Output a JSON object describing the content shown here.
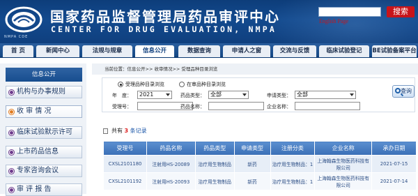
{
  "header": {
    "title": "国家药品监督管理局药品审评中心",
    "subtitle": "CENTER FOR DRUG EVALUATION, NMPA",
    "logo_caption": "NMPA CDE",
    "search_button": "搜索",
    "english_link": "English Page"
  },
  "nav": {
    "items": [
      {
        "label": "首 页"
      },
      {
        "label": "新闻中心"
      },
      {
        "label": "法规与规章"
      },
      {
        "label": "信息公开"
      },
      {
        "label": "数据查询"
      },
      {
        "label": "申请人之窗"
      },
      {
        "label": "交流与反馈"
      },
      {
        "label": "临床试验登记"
      },
      {
        "label": "BE试验备案平台"
      }
    ],
    "active_index": 3
  },
  "sidebar": {
    "heading": "信息公开",
    "items": [
      {
        "label": "机构与办事规则",
        "dot": "purple"
      },
      {
        "label": "收 审 情 况",
        "dot": "orange"
      },
      {
        "label": "临床试验默示许可",
        "dot": "purple"
      },
      {
        "label": "上市药品信息",
        "dot": "purple"
      },
      {
        "label": "专家咨询会议",
        "dot": "purple"
      },
      {
        "label": "审 评 报 告",
        "dot": "purple"
      }
    ]
  },
  "main": {
    "breadcrumb": "当前位置：信息公开>> 收审情况>> 受理品种目录浏览",
    "radios": [
      {
        "label": "受理品种目录浏览",
        "checked": true
      },
      {
        "label": "在审品种目录浏览",
        "checked": false
      }
    ],
    "filters": {
      "year_label": "年　度：",
      "year_value": "2021",
      "drug_type_label": "药品类型：",
      "drug_type_value": "全部",
      "apply_type_label": "申请类型：",
      "apply_type_value": "全部",
      "accept_no_label": "受理号：",
      "drug_name_label": "药品名称：",
      "company_label": "企业名称："
    },
    "query_button": "查询",
    "result": {
      "prefix": "共有",
      "count": "3",
      "suffix": "条记录"
    },
    "table": {
      "columns": [
        "受理号",
        "药品名称",
        "药品类型",
        "申请类型",
        "注册分类",
        "企业名称",
        "承办日期"
      ],
      "rows": [
        [
          "CXSL2101180",
          "注射用HS-20089",
          "治疗用生物制品",
          "新药",
          "治疗用生物制品：1",
          "上海翰森生物医药科技有限公司",
          "2021-07-15"
        ],
        [
          "CXSL2101192",
          "注射用HS-20093",
          "治疗用生物制品",
          "新药",
          "治疗用生物制品：1",
          "上海翰森生物医药科技有限公司",
          "2021-07-14"
        ]
      ]
    }
  }
}
